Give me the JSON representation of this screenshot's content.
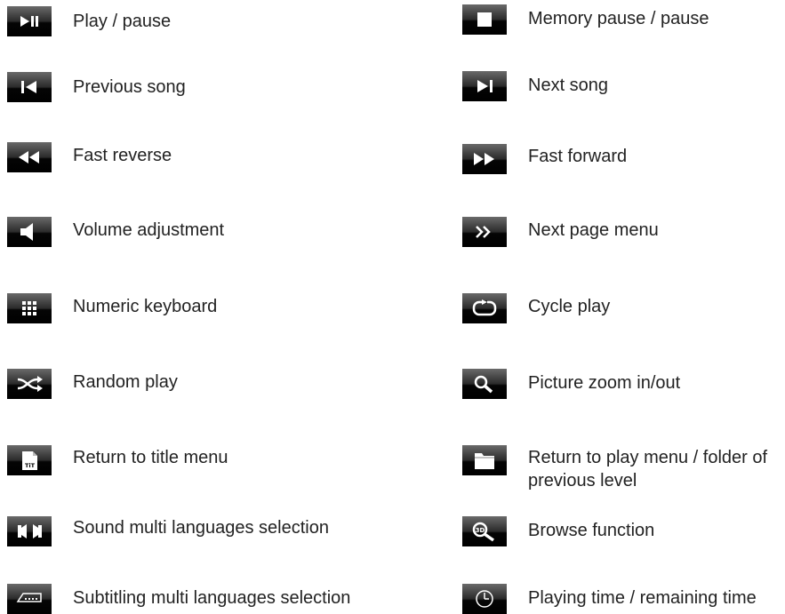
{
  "legend": {
    "left": [
      {
        "icon": "play-pause-icon",
        "label": "Play / pause"
      },
      {
        "icon": "previous-song-icon",
        "label": "Previous song"
      },
      {
        "icon": "fast-reverse-icon",
        "label": "Fast reverse"
      },
      {
        "icon": "volume-icon",
        "label": "Volume adjustment"
      },
      {
        "icon": "numeric-keyboard-icon",
        "label": "Numeric keyboard"
      },
      {
        "icon": "random-play-icon",
        "label": "Random play"
      },
      {
        "icon": "title-menu-icon",
        "label": "Return to title menu"
      },
      {
        "icon": "audio-language-icon",
        "label": "Sound multi languages selection"
      },
      {
        "icon": "subtitle-language-icon",
        "label": "Subtitling multi languages selection"
      }
    ],
    "right": [
      {
        "icon": "stop-icon",
        "label": "Memory pause / pause"
      },
      {
        "icon": "next-song-icon",
        "label": "Next song"
      },
      {
        "icon": "fast-forward-icon",
        "label": "Fast forward"
      },
      {
        "icon": "next-page-icon",
        "label": "Next page menu"
      },
      {
        "icon": "cycle-play-icon",
        "label": "Cycle play"
      },
      {
        "icon": "zoom-icon",
        "label": "Picture zoom in/out"
      },
      {
        "icon": "folder-icon",
        "label": "Return to play menu / folder of previous level"
      },
      {
        "icon": "browse-icon",
        "label": "Browse function"
      },
      {
        "icon": "playing-time-icon",
        "label": "Playing time / remaining time"
      }
    ]
  }
}
